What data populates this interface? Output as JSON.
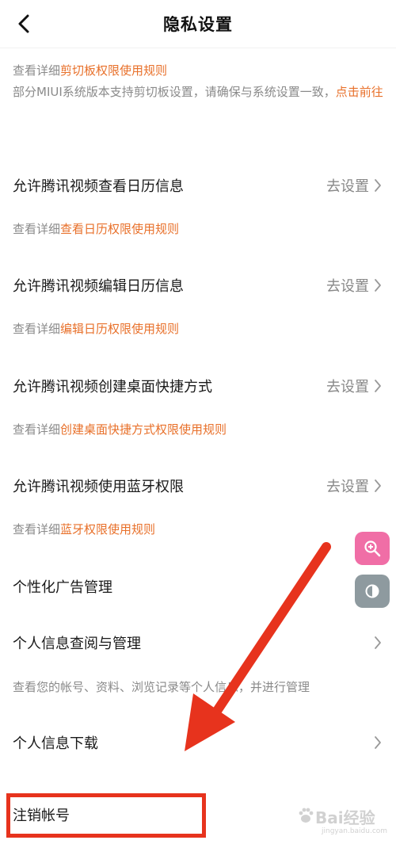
{
  "header": {
    "title": "隐私设置",
    "back_icon": "chevron-left-icon"
  },
  "clipboard_note": {
    "prefix": "查看详细",
    "link": "剪切板权限使用规则",
    "text": "部分MIUI系统版本支持剪切板设置，请确保与系统设置一致，",
    "action_link": "点击前往"
  },
  "calendar_view": {
    "label": "允许腾讯视频查看日历信息",
    "value": "去设置",
    "note_prefix": "查看详细",
    "note_link": "查看日历权限使用规则"
  },
  "calendar_edit": {
    "label": "允许腾讯视频编辑日历信息",
    "value": "去设置",
    "note_prefix": "查看详细",
    "note_link": "编辑日历权限使用规则"
  },
  "shortcut": {
    "label": "允许腾讯视频创建桌面快捷方式",
    "value": "去设置",
    "note_prefix": "查看详细",
    "note_link": "创建桌面快捷方式权限使用规则"
  },
  "bluetooth": {
    "label": "允许腾讯视频使用蓝牙权限",
    "value": "去设置",
    "note_prefix": "查看详细",
    "note_link": "蓝牙权限使用规则"
  },
  "ads": {
    "label": "个性化广告管理"
  },
  "personal_info": {
    "label": "个人信息查阅与管理",
    "note": "查看您的帐号、资料、浏览记录等个人信息，并进行管理"
  },
  "download": {
    "label": "个人信息下载"
  },
  "deactivate": {
    "label": "注销帐号"
  },
  "floating_tools": {
    "zoom_icon": "zoom-in-icon",
    "contrast_icon": "contrast-icon"
  },
  "watermark": {
    "text": "Bai经验",
    "sub": "jingyan.baidu.com"
  },
  "colors": {
    "link": "#e8702a",
    "annotation_red": "#e7331d",
    "float_pink": "#f06ea6",
    "float_gray": "#8e9a9f"
  }
}
